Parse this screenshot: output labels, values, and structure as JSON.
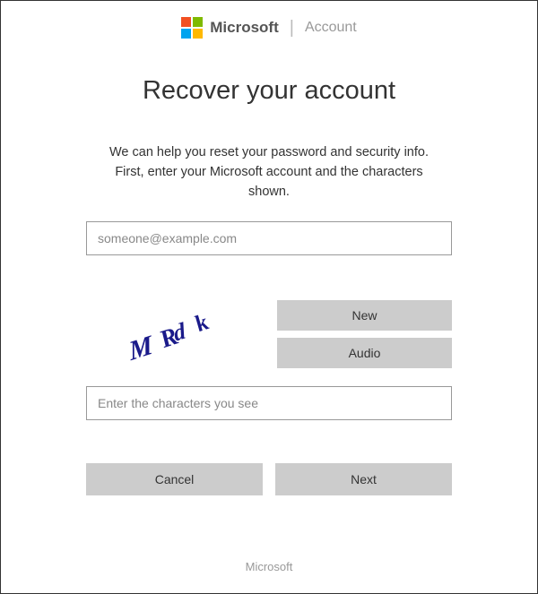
{
  "header": {
    "brand": "Microsoft",
    "section": "Account"
  },
  "page": {
    "title": "Recover your account",
    "instructions": "We can help you reset your password and security info. First, enter your Microsoft account and the characters shown."
  },
  "form": {
    "email_placeholder": "someone@example.com",
    "captcha_text": "MRdk",
    "captcha_new": "New",
    "captcha_audio": "Audio",
    "captcha_input_placeholder": "Enter the characters you see",
    "cancel": "Cancel",
    "next": "Next"
  },
  "footer": {
    "text": "Microsoft"
  }
}
